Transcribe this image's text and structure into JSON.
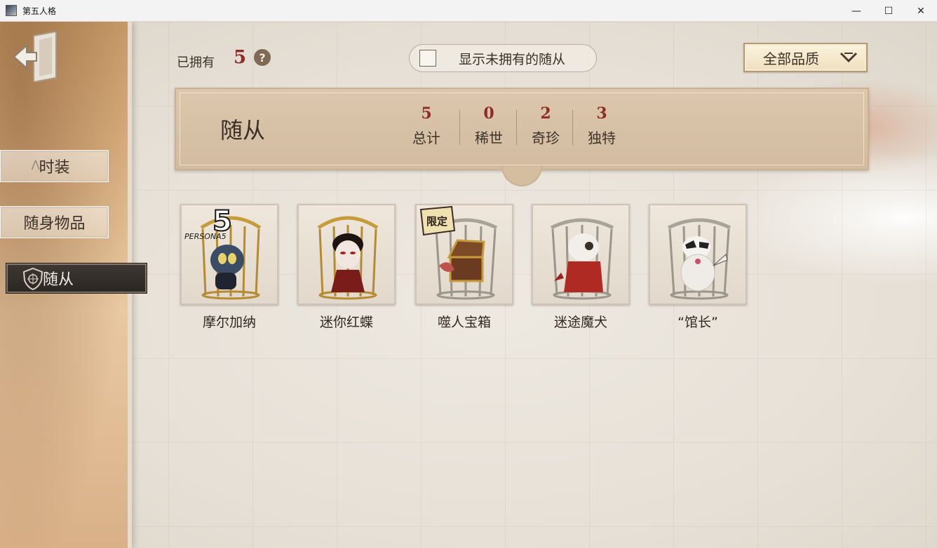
{
  "window": {
    "title": "第五人格",
    "controls": {
      "minimize": "—",
      "maximize": "☐",
      "close": "✕"
    }
  },
  "nav": {
    "items": [
      {
        "label": "时装"
      },
      {
        "label": "随身物品"
      },
      {
        "label": "随从"
      }
    ],
    "active": "随从"
  },
  "toolbar": {
    "owned_label": "已拥有",
    "owned_count": "5",
    "help_icon": "?",
    "show_unowned_label": "显示未拥有的随从",
    "quality_label": "全部品质"
  },
  "banner": {
    "title": "随从",
    "stats": [
      {
        "value": "5",
        "label": "总计"
      },
      {
        "value": "0",
        "label": "稀世"
      },
      {
        "value": "2",
        "label": "奇珍"
      },
      {
        "value": "3",
        "label": "独特"
      }
    ]
  },
  "items": [
    {
      "name": "摩尔加纳",
      "logo_text": "PERSONA5",
      "cage": "gold"
    },
    {
      "name": "迷你红蝶",
      "cage": "gold"
    },
    {
      "name": "噬人宝箱",
      "badge": "限定",
      "cage": "silver"
    },
    {
      "name": "迷途魔犬",
      "cage": "silver"
    },
    {
      "name": "“馆长”",
      "cage": "silver"
    }
  ],
  "colors": {
    "accent_red": "#8e2c26",
    "nav_active_bg": "#2a2622",
    "banner_bg": "#d2bb9f"
  }
}
